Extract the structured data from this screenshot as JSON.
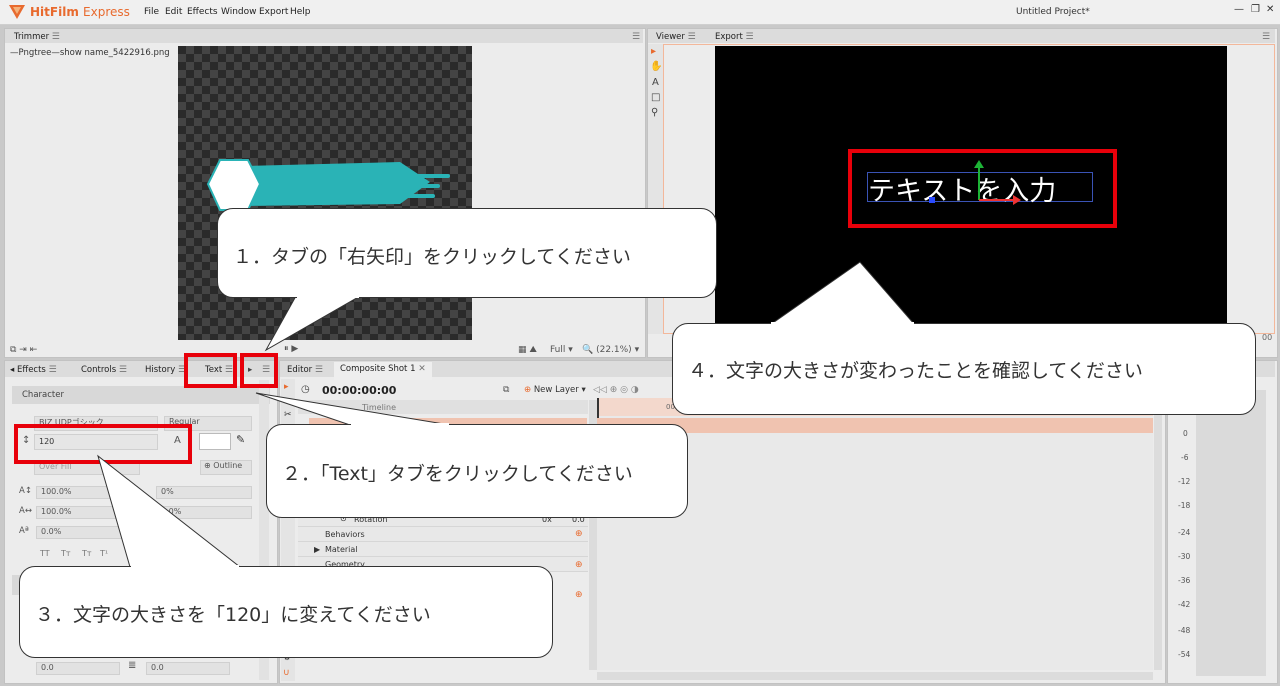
{
  "app": {
    "name_bold": "HitFilm",
    "name_light": "Express",
    "project_title": "Untitled Project*",
    "menus": [
      "File",
      "Edit",
      "Effects",
      "Window",
      "Export",
      "Help"
    ],
    "window_buttons": [
      "—",
      "❐",
      "✕"
    ]
  },
  "trimmer": {
    "tab": "Trimmer",
    "file_name": "—Pngtree—show name_5422916.png"
  },
  "viewer": {
    "tabs": [
      "Viewer",
      "Export"
    ],
    "text_content": "テキストを入力",
    "tools": [
      "▸",
      "✋",
      "A",
      "□",
      "⚲"
    ]
  },
  "toolbar_trimmer": {
    "quality": "Full",
    "zoom": "(22.1%)"
  },
  "lower_tabs": {
    "effects": "Effects",
    "controls": "Controls",
    "history": "History",
    "text": "Text"
  },
  "text_panel": {
    "section": "Character",
    "font_value": "BIZ UDPゴシック",
    "style_value": "Regular",
    "size_value": "120",
    "fill_label": "Over Fill",
    "outline_label": "Outline",
    "scale_v": "100.0%",
    "scale_h": "100.0%",
    "baseline": "0.0%",
    "kerning": "0%",
    "tracking": "0.0%",
    "case_buttons": [
      "TT",
      "Tт",
      "Tт",
      "T¹"
    ],
    "bottom_val1": "0.0",
    "bottom_val2": "0.0"
  },
  "editor": {
    "tab": "Editor",
    "composite_tab": "Composite Shot 1",
    "timecode": "00:00:00:00",
    "new_layer": "New Layer",
    "timeline_label": "Timeline",
    "rotation_label": "Rotation",
    "rotation_v1": "0x",
    "rotation_v2": "0.0",
    "behaviors": "Behaviors",
    "material": "Material",
    "geometry": "Geometry",
    "ruler_start": "00"
  },
  "meter": {
    "ticks": [
      "0",
      "-6",
      "-12",
      "-18",
      "-24",
      "-30",
      "-36",
      "-42",
      "-48",
      "-54"
    ]
  },
  "callouts": {
    "c1": "１．タブの「右矢印」をクリックしてください",
    "c2": "２．「Text」タブをクリックしてください",
    "c3": "３．文字の大きさを「120」に変えてください",
    "c4": "４．文字の大きさが変わったことを確認してください"
  },
  "colors": {
    "accent": "#e86a2e",
    "highlight": "#e8000a",
    "teal": "#2ab3b6"
  }
}
